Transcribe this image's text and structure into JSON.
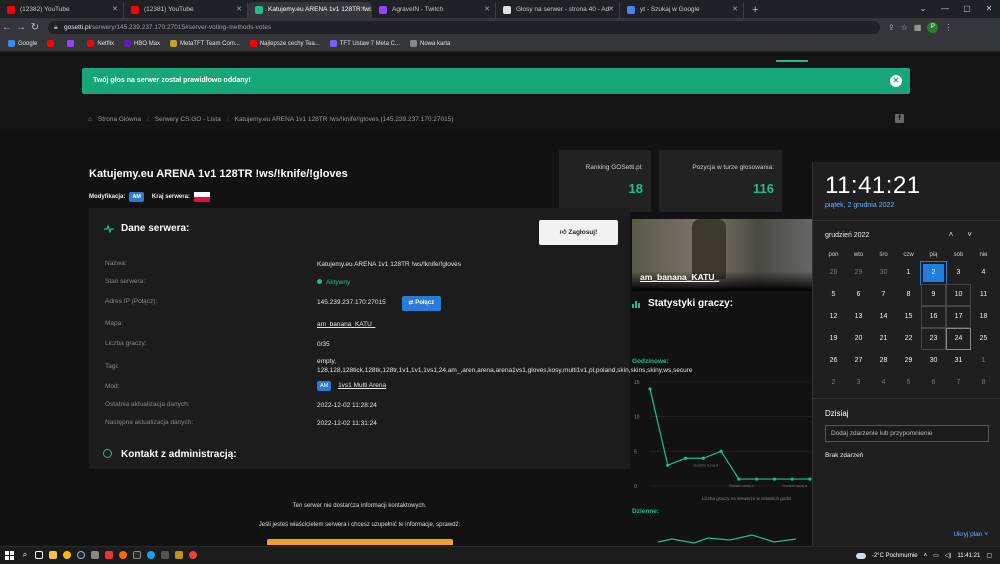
{
  "browser": {
    "tabs": [
      {
        "title": "(12382) YouTube",
        "color": "#ff0000",
        "active": false
      },
      {
        "title": "(12381) YouTube",
        "color": "#ff0000",
        "active": false
      },
      {
        "title": "Katujemy.eu ARENA 1v1 128TR !ws/",
        "color": "#1cc088",
        "active": true
      },
      {
        "title": "AgraveIN - Twitch",
        "color": "#9146ff",
        "active": false
      },
      {
        "title": "Głosy na serwer - strona 40 - Ad",
        "color": "#e0e0e0",
        "active": false
      },
      {
        "title": "yt - Szukaj w Google",
        "color": "#4285f4",
        "active": false
      }
    ],
    "new_tab": "+",
    "url_host": "gosetti.pl",
    "url_path": "/serwery/145.239.237.170:27015#server-voting-methods-votes",
    "profile_initial": "P",
    "bookmarks": [
      {
        "label": "Google",
        "color": "#4285f4"
      },
      {
        "label": "",
        "color": "#ff0000"
      },
      {
        "label": "",
        "color": "#9146ff"
      },
      {
        "label": "Netflix",
        "color": "#e50914"
      },
      {
        "label": "HBO Max",
        "color": "#5822b4"
      },
      {
        "label": "MetaTFT Team Com...",
        "color": "#c9a227"
      },
      {
        "label": "Najlepsze cechy Tea...",
        "color": "#ff0000"
      },
      {
        "label": "TFT Ustaw 7 Meta C...",
        "color": "#7a5cff"
      },
      {
        "label": "Nowa karta",
        "color": "#888888"
      }
    ]
  },
  "site": {
    "alert": "Twój głos na serwer został prawidłowo oddany!",
    "breadcrumb": [
      "Strona Główna",
      "Serwery CS:GO - Lista",
      "Katujemy.eu ARENA 1v1 128TR !ws/!knife/!gloves (145.239.237.170:27015)"
    ],
    "server_title": "Katujemy.eu ARENA 1v1 128TR !ws/!knife/!gloves",
    "mod_label": "Modyfikacja:",
    "mod_badge": "AM",
    "country_label": "Kraj serwera:",
    "rank_label": "Ranking GOSetti.pl:",
    "rank_value": "18",
    "position_label": "Pozycja w turze głosowania:",
    "position_value": "116",
    "panel_title": "Dane serwera:",
    "vote_button": "Zagłosuj!",
    "details": {
      "name_label": "Nazwa:",
      "name": "Katujemy.eu ARENA 1v1 128TR !ws/!knife/!gloves",
      "status_label": "Stan serwera:",
      "status": "Aktywny",
      "ip_label": "Adres IP (Połącz):",
      "ip": "145.239.237.170:27015",
      "connect": "Połącz",
      "map_label": "Mapa:",
      "map": "am_banana_KATU_",
      "players_label": "Liczba graczy:",
      "players": "0/35",
      "tags_label": "Tagi:",
      "tags": "empty, 128,128,128tick,128tk,128tr,1v1,1v1,1vs1,24,am_,aren,arena,arena1vs1,gloves,kosy,multi1v1,pl,poland,skin,skins,skiny,ws,secure",
      "mod_label": "Mod:",
      "mod_badge": "AM",
      "mod": "1vs1 Multi Arena",
      "last_update_label": "Ostatnia aktualizacja danych:",
      "last_update": "2022-12-02 11:28:24",
      "next_update_label": "Następna aktualizacja danych:",
      "next_update": "2022-12-02 11:31:24"
    },
    "contact_title": "Kontakt z administracją:",
    "contact_info": "Ten serwer nie dostarcza informacji kontaktowych.",
    "contact_owner": "Jeśli jesteś właścicielem serwera i chcesz uzupełnić te informacje, sprawdź:",
    "map_image_name": "am_banana_KATU_",
    "stats_title": "Statystyki graczy:",
    "hourly_label": "Godzinowe:",
    "daily_label": "Dzienne:",
    "hourly_caption": "Liczba graczy na serwerze w ostatnich godzi",
    "chart_point_labels": [
      "Godzin tuna a",
      "Godzin tuna a",
      "Godzin tuna a"
    ]
  },
  "chart_data": {
    "type": "line",
    "title": "Godzinowe:",
    "y_ticks": [
      "15",
      "10",
      "5",
      "0"
    ],
    "ylim": [
      0,
      15
    ],
    "values": [
      14,
      3,
      4,
      4,
      5,
      1,
      1,
      1,
      1,
      1
    ],
    "color": "#1cc088"
  },
  "calendar": {
    "time": "11:41:21",
    "date": "piątek, 2 grudnia 2022",
    "month": "grudzień 2022",
    "weekdays": [
      "pon",
      "wto",
      "śro",
      "czw",
      "pią",
      "sob",
      "nie"
    ],
    "weeks": [
      [
        "28",
        "29",
        "30",
        "1",
        "2",
        "3",
        "4"
      ],
      [
        "5",
        "6",
        "7",
        "8",
        "9",
        "10",
        "11"
      ],
      [
        "12",
        "13",
        "14",
        "15",
        "16",
        "17",
        "18"
      ],
      [
        "19",
        "20",
        "21",
        "22",
        "23",
        "24",
        "25"
      ],
      [
        "26",
        "27",
        "28",
        "29",
        "30",
        "31",
        "1"
      ],
      [
        "2",
        "3",
        "4",
        "5",
        "6",
        "7",
        "8"
      ]
    ],
    "today_label": "Dzisiaj",
    "event_placeholder": "Dodaj zdarzenie lub przypomnienie",
    "no_events": "Brak zdarzeń",
    "hide_plan": "Ukryj plan"
  },
  "taskbar": {
    "weather": "-2°C  Pochmurnie",
    "clock": "11:41:21"
  }
}
